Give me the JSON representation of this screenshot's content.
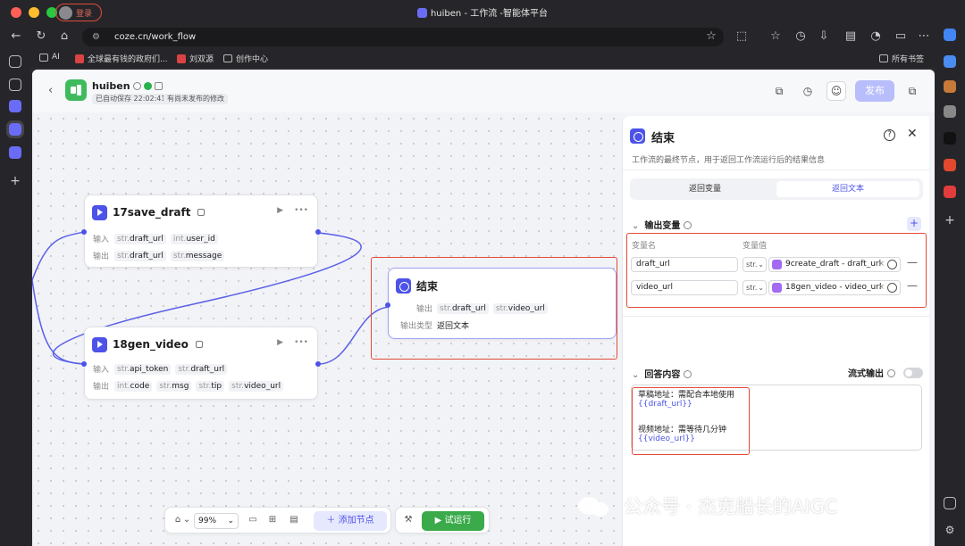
{
  "window": {
    "title": "huiben - 工作流 -智能体平台",
    "login": "登录",
    "colors": {
      "close": "#ff5f57",
      "min": "#febc2e",
      "max": "#28c840"
    }
  },
  "browser": {
    "url": "coze.cn/work_flow",
    "bookmarks": [
      "AI",
      "全球最有钱的政府们...",
      "刘双源",
      "创作中心"
    ],
    "all_bookmarks": "所有书签"
  },
  "header": {
    "workflow_name": "huiben",
    "autosave": "已自动保存 22:02:41",
    "unpublished": "有尚未发布的修改",
    "publish_label": "发布"
  },
  "nodes": {
    "save_draft": {
      "title": "17save_draft",
      "input_label": "输入",
      "output_label": "输出",
      "inputs": [
        {
          "type": "str.",
          "name": "draft_url"
        },
        {
          "type": "int.",
          "name": "user_id"
        }
      ],
      "outputs": [
        {
          "type": "str.",
          "name": "draft_url"
        },
        {
          "type": "str.",
          "name": "message"
        }
      ]
    },
    "gen_video": {
      "title": "18gen_video",
      "input_label": "输入",
      "output_label": "输出",
      "inputs": [
        {
          "type": "str.",
          "name": "api_token"
        },
        {
          "type": "str.",
          "name": "draft_url"
        }
      ],
      "outputs": [
        {
          "type": "int.",
          "name": "code"
        },
        {
          "type": "str.",
          "name": "msg"
        },
        {
          "type": "str.",
          "name": "tip"
        },
        {
          "type": "str.",
          "name": "video_url"
        }
      ]
    },
    "end": {
      "title": "结束",
      "output_label": "输出",
      "outputs": [
        {
          "type": "str.",
          "name": "draft_url"
        },
        {
          "type": "str.",
          "name": "video_url"
        }
      ],
      "output_type_label": "输出类型",
      "output_type_value": "返回文本"
    }
  },
  "bottom_bar": {
    "zoom": "99%",
    "add_node": "添加节点",
    "test_run": "试运行"
  },
  "panel": {
    "title": "结束",
    "description": "工作流的最终节点，用于返回工作流运行后的结果信息",
    "tabs": [
      {
        "label": "返回变量",
        "active": false
      },
      {
        "label": "返回文本",
        "active": true
      }
    ],
    "output_section": "输出变量",
    "col_name": "变量名",
    "col_value": "变量值",
    "variables": [
      {
        "name": "draft_url",
        "type": "str.",
        "ref": "9create_draft - draft_url"
      },
      {
        "name": "video_url",
        "type": "str.",
        "ref": "18gen_video - video_url"
      }
    ],
    "answer_section": "回答内容",
    "stream_label": "流式输出",
    "answer_lines": [
      "草稿地址：需配合本地使用",
      "{{draft_url}}",
      "视频地址：需等待几分钟",
      "{{video_url}}"
    ],
    "accent": "#4d53e8"
  },
  "watermark": "公众号 · 杰克船长的AIGC"
}
